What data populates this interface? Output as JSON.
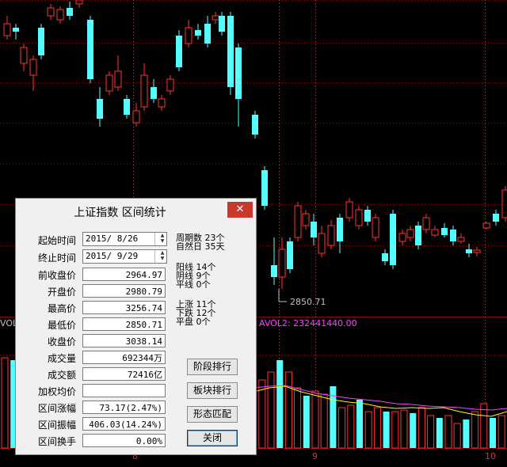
{
  "chart": {
    "vol_label": "VOL",
    "vol2_label": "AVOL2: 232441440.00",
    "low_price_label": "2850.71",
    "x_labels": [
      "8",
      "9",
      "10"
    ],
    "colors": {
      "up": "#ff3232",
      "down": "#54ffff",
      "grid": "#8b0000",
      "ma1": "#ffff00",
      "ma2": "#ff40ff"
    }
  },
  "dialog": {
    "title": "上证指数 区间统计",
    "close_label": "✕",
    "start_time_label": "起始时间",
    "start_time_value": "2015/ 8/26",
    "end_time_label": "终止时间",
    "end_time_value": "2015/ 9/29",
    "rows": [
      {
        "label": "前收盘价",
        "value": "2964.97"
      },
      {
        "label": "开盘价",
        "value": "2980.79"
      },
      {
        "label": "最高价",
        "value": "3256.74"
      },
      {
        "label": "最低价",
        "value": "2850.71"
      },
      {
        "label": "收盘价",
        "value": "3038.14"
      },
      {
        "label": "成交量",
        "value": "692344万"
      },
      {
        "label": "成交额",
        "value": "72416亿"
      },
      {
        "label": "加权均价",
        "value": ""
      },
      {
        "label": "区间涨幅",
        "value": "73.17(2.47%)"
      },
      {
        "label": "区间振幅",
        "value": "406.03(14.24%)"
      },
      {
        "label": "区间换手",
        "value": "0.00%"
      }
    ],
    "stats": {
      "period_count": "周期数 23个",
      "natural_days": "自然日 35天",
      "yang_lines": "阳线 14个",
      "yin_lines": "阴线 9个",
      "flat_lines": "平线 0个",
      "up_count": "上涨 11个",
      "down_count": "下跌 12个",
      "flat_count": "平盘 0个"
    },
    "buttons": {
      "stage_rank": "阶段排行",
      "sector_rank": "板块排行",
      "pattern_match": "形态匹配",
      "close": "关闭"
    }
  }
}
